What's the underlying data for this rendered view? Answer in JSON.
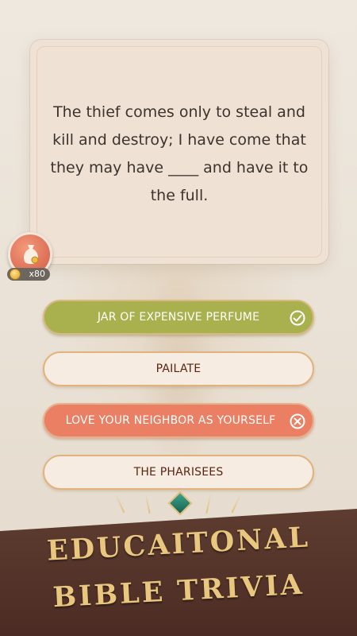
{
  "question": {
    "text": "The thief comes only to steal and kill and destroy; I have come that they may have ____ and have it to the full."
  },
  "hint": {
    "count_label": "x80",
    "icon": "money-bag-icon"
  },
  "options": [
    {
      "label": "JAR OF EXPENSIVE PERFUME",
      "state": "correct",
      "icon": "check-circle-icon"
    },
    {
      "label": "PAILATE",
      "state": "default"
    },
    {
      "label": "LOVE YOUR NEIGHBOR AS YOURSELF",
      "state": "wrong",
      "icon": "x-circle-icon"
    },
    {
      "label": "THE PHARISEES",
      "state": "default"
    }
  ],
  "banner": {
    "line1": "EDUCAITONAL",
    "line2": "BIBLE TRIVIA"
  },
  "colors": {
    "correct": "#a8b14d",
    "wrong": "#eb7f64",
    "option_text": "#5a2410",
    "banner_text": "#e9c77f"
  }
}
